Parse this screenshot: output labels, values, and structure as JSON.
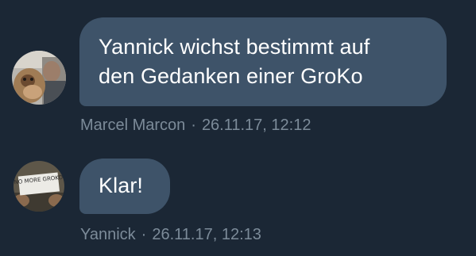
{
  "messages": [
    {
      "lines": [
        "Yannick wichst bestimmt auf",
        "den Gedanken einer GroKo"
      ],
      "author": "Marcel Marcon",
      "separator": "·",
      "timestamp": "26.11.17, 12:12",
      "avatar": "user-photo-marcel-avatar"
    },
    {
      "lines": [
        "Klar!"
      ],
      "author": "Yannick",
      "separator": "·",
      "timestamp": "26.11.17, 12:13",
      "avatar": "user-photo-yannick-avatar",
      "avatar_text": "NO MORE GROKO"
    }
  ],
  "colors": {
    "background": "#1b2735",
    "bubble": "#3e5369",
    "message_text": "#ffffff",
    "meta_text": "#7c8b99"
  }
}
